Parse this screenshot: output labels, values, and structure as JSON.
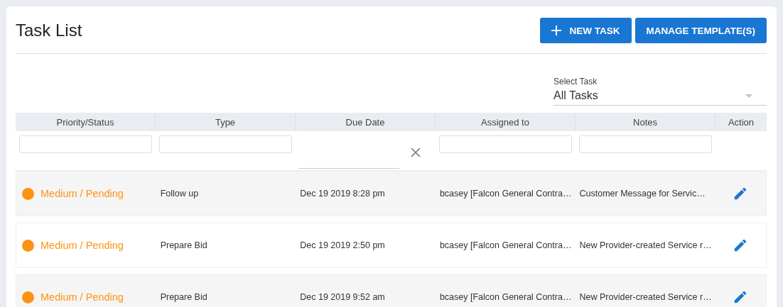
{
  "title": "Task List",
  "actions": [
    {
      "kind": "add",
      "label": "NEW TASK"
    },
    {
      "kind": "plain",
      "label": "MANAGE TEMPLATE(S)"
    }
  ],
  "select_task": {
    "label": "Select Task",
    "value": "All Tasks"
  },
  "table": {
    "columns": [
      "Priority/Status",
      "Type",
      "Due Date",
      "Assigned to",
      "Notes",
      "Action"
    ],
    "filters": [
      {
        "kind": "text"
      },
      {
        "kind": "text"
      },
      {
        "kind": "date"
      },
      {
        "kind": "text"
      },
      {
        "kind": "text"
      },
      {
        "kind": "none"
      }
    ],
    "rows": [
      {
        "status": "Medium / Pending",
        "color": "#ff9214",
        "type": "Follow up",
        "due": "Dec 19 2019 8:28 pm",
        "assigned": "bcasey [Falcon General Contra…",
        "notes": "Customer Message for Servic…"
      },
      {
        "status": "Medium / Pending",
        "color": "#ff9214",
        "type": "Prepare Bid",
        "due": "Dec 19 2019 2:50 pm",
        "assigned": "bcasey [Falcon General Contra…",
        "notes": "New Provider-created Service r…"
      },
      {
        "status": "Medium / Pending",
        "color": "#ff9214",
        "type": "Prepare Bid",
        "due": "Dec 19 2019 9:52 am",
        "assigned": "bcasey [Falcon General Contra…",
        "notes": "New Provider-created Service r…"
      }
    ]
  }
}
